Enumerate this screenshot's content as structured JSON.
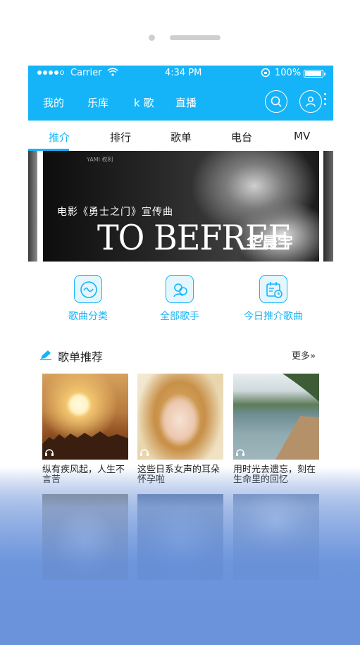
{
  "status_bar": {
    "carrier": "Carrier",
    "time": "4:34 PM",
    "battery": "100%"
  },
  "top_nav": {
    "items": [
      "我的",
      "乐库",
      "k 歌",
      "直播"
    ]
  },
  "tabs": [
    "推介",
    "排行",
    "歌单",
    "电台",
    "MV"
  ],
  "active_tab": "推介",
  "banner": {
    "watermark": "YAMI 权利",
    "subtitle": "电影《勇士之门》宣传曲",
    "title": "TO BEFREE",
    "artist": "华晨宇"
  },
  "quick_links": [
    {
      "label": "歌曲分类",
      "icon": "waveform-icon"
    },
    {
      "label": "全部歌手",
      "icon": "singers-icon"
    },
    {
      "label": "今日推介歌曲",
      "icon": "calendar-icon"
    }
  ],
  "playlist_section": {
    "title": "歌单推荐",
    "more": "更多"
  },
  "playlists": [
    {
      "caption": "纵有疾风起，人生不言苦"
    },
    {
      "caption": "这些日系女声的耳朵怀孕啦"
    },
    {
      "caption": "用时光去遗忘，刻在生命里的回忆"
    },
    {
      "caption": ""
    },
    {
      "caption": ""
    },
    {
      "caption": ""
    }
  ],
  "colors": {
    "accent": "#15b4f8",
    "background_gradient_bottom": "#6a93dc"
  }
}
